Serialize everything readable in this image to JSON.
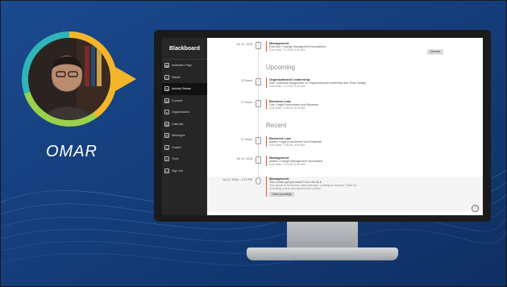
{
  "overlay": {
    "name": "OMAR"
  },
  "app": {
    "brand": "Blackboard"
  },
  "sidebar": {
    "items": [
      {
        "label": "Institution Page",
        "icon": "institution-icon"
      },
      {
        "label": "Sakaili",
        "icon": "user-icon"
      },
      {
        "label": "Activity Stream",
        "icon": "globe-icon"
      },
      {
        "label": "Courses",
        "icon": "book-icon"
      },
      {
        "label": "Organizations",
        "icon": "people-icon"
      },
      {
        "label": "Calendar",
        "icon": "calendar-icon"
      },
      {
        "label": "Messages",
        "icon": "mail-icon"
      },
      {
        "label": "Grades",
        "icon": "grades-icon"
      },
      {
        "label": "Tools",
        "icon": "tools-icon"
      },
      {
        "label": "Sign Out",
        "icon": "signout-icon"
      }
    ]
  },
  "stream": {
    "top": {
      "date": "Jul 12, 2018",
      "title": "Management",
      "line": "Post due: Change Management Innovations",
      "due": "Due Date: 7/17/18, 5:00 AM",
      "dismiss": "Dismiss"
    },
    "upcoming": {
      "heading": "Upcoming",
      "items": [
        {
          "date": "23 hours",
          "title": "Organizational Leadership",
          "line": "Due: Individual Assignment on Organizational Leadership and Team Design",
          "due": "Due Date: 7/17/18, 5:00 AM"
        },
        {
          "date": "27 hours",
          "title": "Business Law",
          "line": "Due: Legal Environment and Business",
          "due": "Due Date: 7/19/18, 5:00 AM"
        }
      ]
    },
    "recent": {
      "heading": "Recent",
      "items": [
        {
          "date": "27 hours",
          "title": "Business Law",
          "line": "Added: Legal Environment and Business",
          "due": "Due Date: 7/19/18, 5:00 AM"
        },
        {
          "date": "Jul 12, 2018",
          "title": "Management",
          "line": "Added: Change Management Innovations",
          "due": "Due Date: 7/17/18, 5:00 AM"
        }
      ]
    },
    "alert": {
      "date": "Jul 12, 2018 – 2:15 PM",
      "title": "Management",
      "line1": "This course got you down? You can do it.",
      "line2": "Your grade is below the class average. Looking to improve? Start by",
      "line3": "reviewing where you stand in the course.",
      "button": "View my activity"
    }
  },
  "colors": {
    "accent": "#e05a2b",
    "sidebar": "#262626",
    "background": "#16407f"
  }
}
